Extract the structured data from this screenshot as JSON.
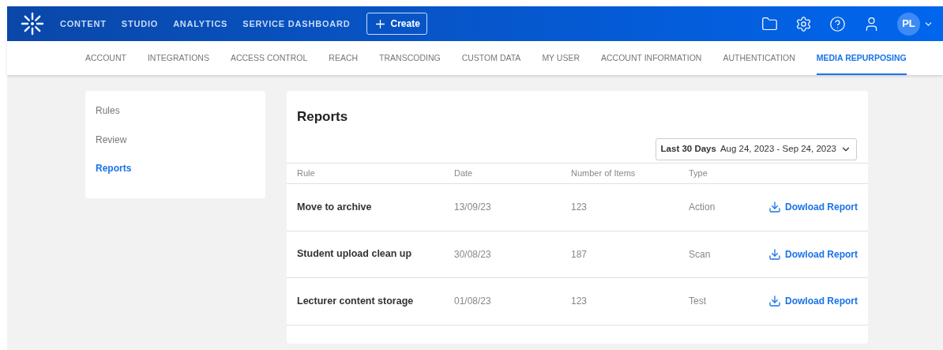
{
  "top_nav": {
    "items": [
      "CONTENT",
      "STUDIO",
      "ANALYTICS",
      "SERVICE DASHBOARD"
    ],
    "create_button": "Create",
    "avatar": "PL"
  },
  "tabs": [
    {
      "label": "ACCOUNT",
      "selected": false
    },
    {
      "label": "INTEGRATIONS",
      "selected": false
    },
    {
      "label": "ACCESS CONTROL",
      "selected": false
    },
    {
      "label": "REACH",
      "selected": false
    },
    {
      "label": "TRANSCODING",
      "selected": false
    },
    {
      "label": "CUSTOM DATA",
      "selected": false
    },
    {
      "label": "MY USER",
      "selected": false
    },
    {
      "label": "ACCOUNT INFORMATION",
      "selected": false
    },
    {
      "label": "AUTHENTICATION",
      "selected": false
    },
    {
      "label": "MEDIA REPURPOSING",
      "selected": true
    }
  ],
  "sidebar": {
    "items": [
      {
        "label": "Rules",
        "selected": false
      },
      {
        "label": "Review",
        "selected": false
      },
      {
        "label": "Reports",
        "selected": true
      }
    ]
  },
  "reports": {
    "title": "Reports",
    "date_range": {
      "preset": "Last 30 Days",
      "range": "Aug 24, 2023 - Sep 24, 2023"
    },
    "table": {
      "columns": [
        "Rule",
        "Date",
        "Number of Items",
        "Type"
      ],
      "rows": [
        {
          "rule": "Move to archive",
          "date": "13/09/23",
          "items": "123",
          "type": "Action",
          "action": "Dowload Report"
        },
        {
          "rule": "Student upload clean up",
          "date": "30/08/23",
          "items": "187",
          "type": "Scan",
          "action": "Dowload Report"
        },
        {
          "rule": "Lecturer content storage",
          "date": "01/08/23",
          "items": "123",
          "type": "Test",
          "action": "Dowload Report"
        }
      ]
    }
  }
}
